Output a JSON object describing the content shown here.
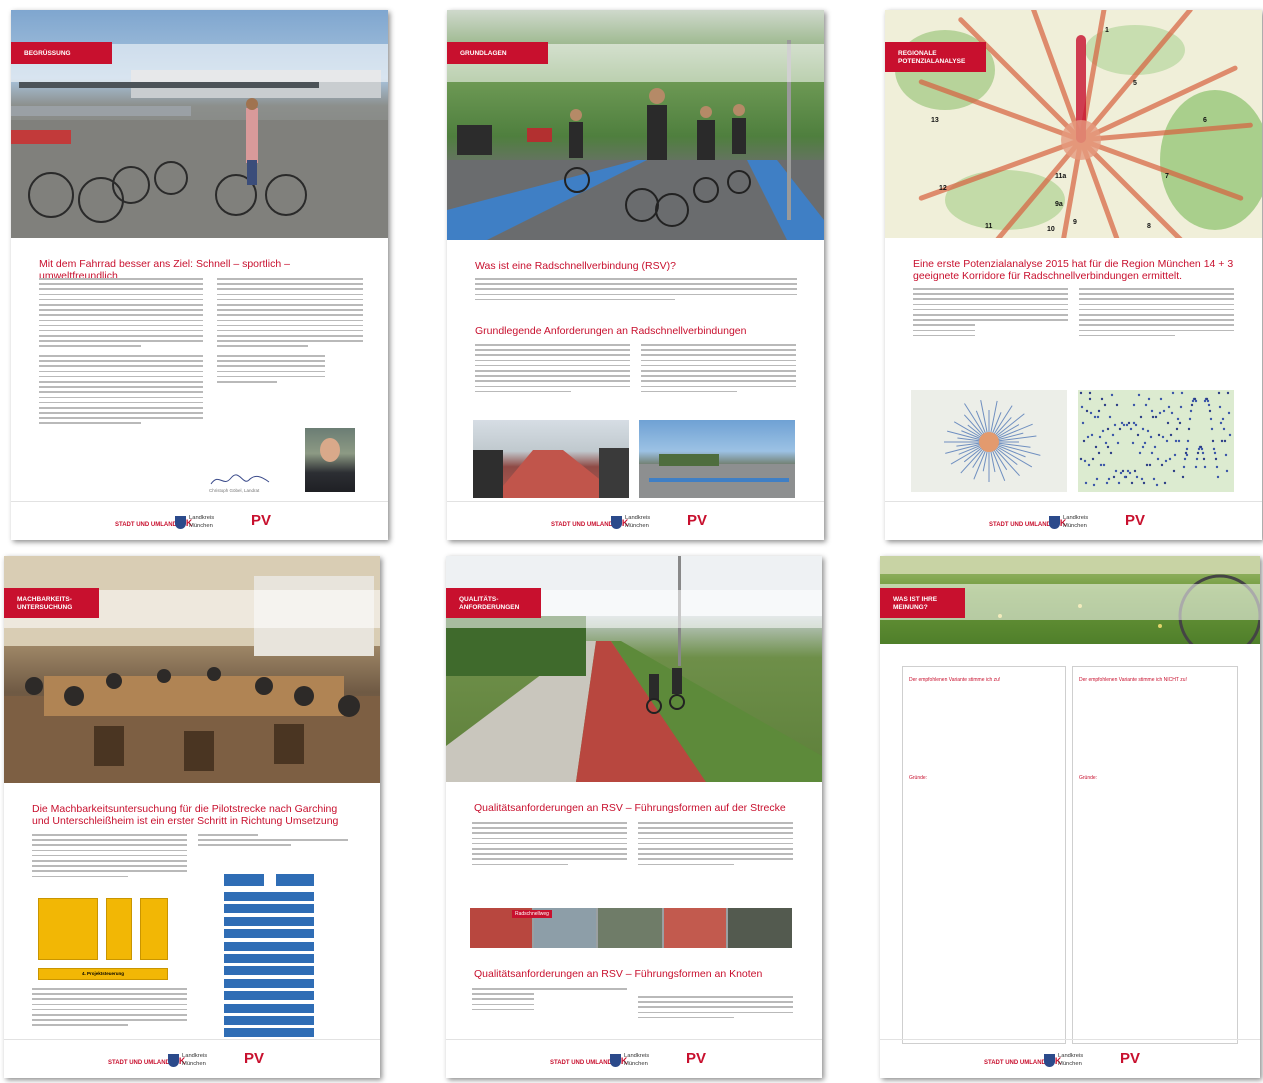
{
  "posters": [
    {
      "section": "Begrüssung",
      "title": "Mit dem Fahrrad besser ans Ziel: Schnell – sportlich – umweltfreundlich",
      "signature": "Christoph Göbel, Landrat"
    },
    {
      "section": "Grundlagen",
      "title": "Was ist eine Radschnellverbindung (RSV)?",
      "subtitle": "Grundlegende Anforderungen an Radschnellverbindungen"
    },
    {
      "section": "Regionale Potenzialanalyse",
      "title": "Eine erste Potenzialanalyse 2015 hat für die Region München 14 + 3 geeignete Korridore für Radschnellverbindungen ermittelt.",
      "map_numbers": [
        "1",
        "5",
        "6",
        "7",
        "8",
        "9",
        "9a",
        "10",
        "11",
        "11a",
        "12",
        "13"
      ]
    },
    {
      "section": "Machbarkeits-untersuchung",
      "title": "Die Machbarkeitsuntersuchung für die Pilotstrecke nach Garching und Unterschleißheim ist ein erster Schritt in Richtung Umsetzung",
      "diagram_footer": "4. Projektsteuerung"
    },
    {
      "section": "Qualitäts-anforderungen",
      "title": "Qualitätsanforderungen an RSV – Führungsformen auf der Strecke",
      "subtitle": "Qualitätsanforderungen an RSV – Führungsformen an Knoten",
      "strip_label": "Radschnellweg"
    },
    {
      "section": "Was ist Ihre Meinung?",
      "box_left": "Der empfohlenen Variante stimme ich zu!",
      "box_right": "Der empfohlenen Variante stimme ich NICHT zu!",
      "reason_label": "Gründe:"
    }
  ],
  "footer": {
    "sk_text": "STADT UND UMLAND",
    "sk_abbr": "SK",
    "district_line1": "Landkreis",
    "district_line2": "München",
    "pv_abbr": "PV"
  },
  "colors": {
    "accent": "#c8102e",
    "text_gray": "#b9b9b9",
    "diagram_yellow": "#f2b705",
    "diagram_blue": "#2f6db5"
  }
}
